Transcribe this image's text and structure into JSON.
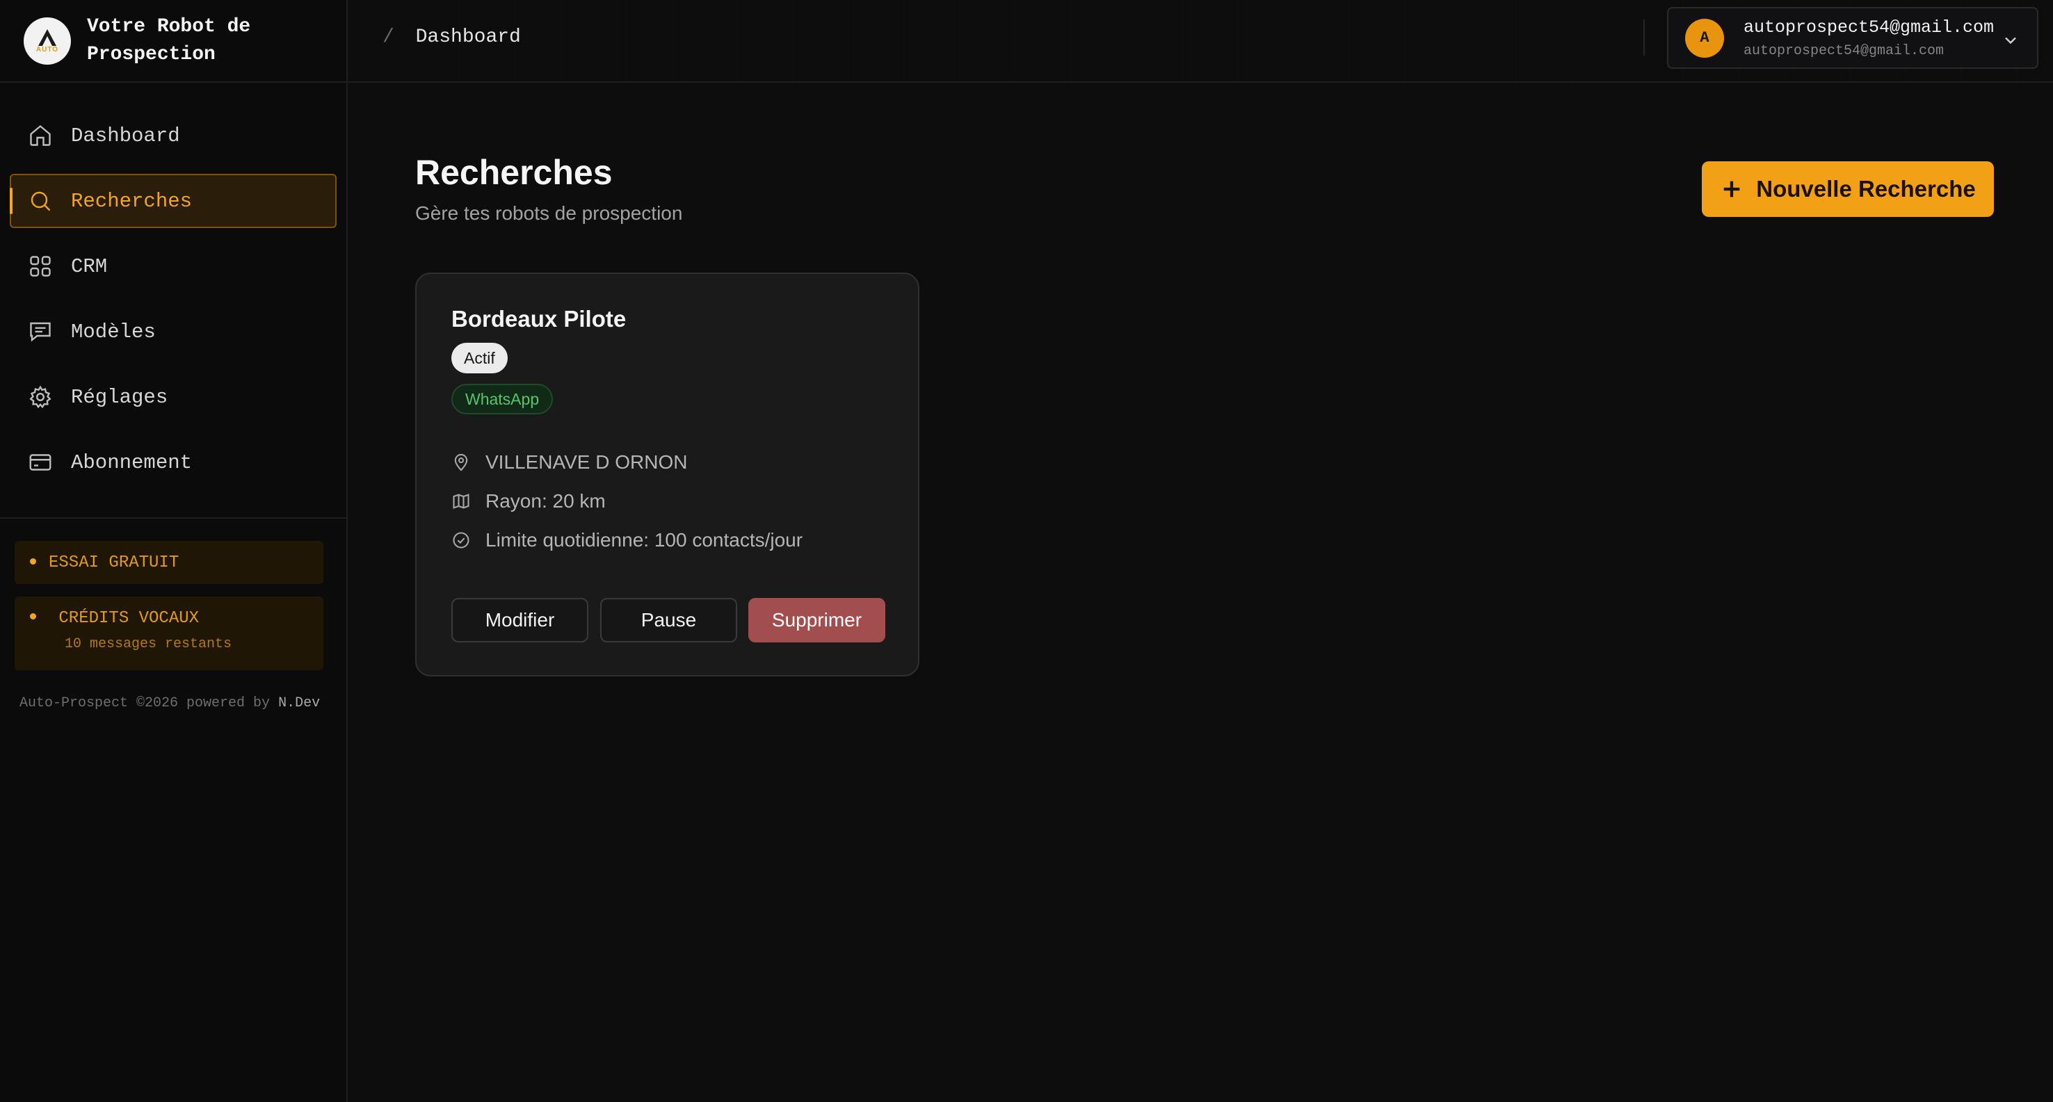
{
  "brand": {
    "title": "Votre Robot de Prospection",
    "logo_text": "AUTO"
  },
  "sidebar": {
    "items": [
      {
        "label": "Dashboard",
        "icon": "home-icon"
      },
      {
        "label": "Recherches",
        "icon": "search-icon",
        "active": true
      },
      {
        "label": "CRM",
        "icon": "grid-icon"
      },
      {
        "label": "Modèles",
        "icon": "message-icon"
      },
      {
        "label": "Réglages",
        "icon": "gear-icon"
      },
      {
        "label": "Abonnement",
        "icon": "credit-card-icon"
      }
    ],
    "trial_label": "ESSAI GRATUIT",
    "credits_label": "CRÉDITS VOCAUX",
    "credits_sub": "10 messages restants",
    "footer_prefix": "Auto-Prospect ©2026 powered by",
    "footer_brand": "N.Dev"
  },
  "header": {
    "breadcrumb_sep": "/",
    "breadcrumb": "Dashboard",
    "user_initial": "A",
    "user_name": "autoprospect54@gmail.com",
    "user_email": "autoprospect54@gmail.com"
  },
  "main": {
    "title": "Recherches",
    "subtitle": "Gère tes robots de prospection",
    "new_button": "Nouvelle Recherche",
    "cards": [
      {
        "title": "Bordeaux Pilote",
        "status": "Actif",
        "channel": "WhatsApp",
        "location": "VILLENAVE D ORNON",
        "radius": "Rayon: 20 km",
        "daily_limit": "Limite quotidienne: 100 contacts/jour",
        "edit_label": "Modifier",
        "pause_label": "Pause",
        "delete_label": "Supprimer"
      }
    ]
  },
  "colors": {
    "accent": "#f2a116",
    "background": "#0d0d0e",
    "card": "#1a1a1b",
    "danger": "#a24e4f",
    "success": "#55c66e"
  }
}
